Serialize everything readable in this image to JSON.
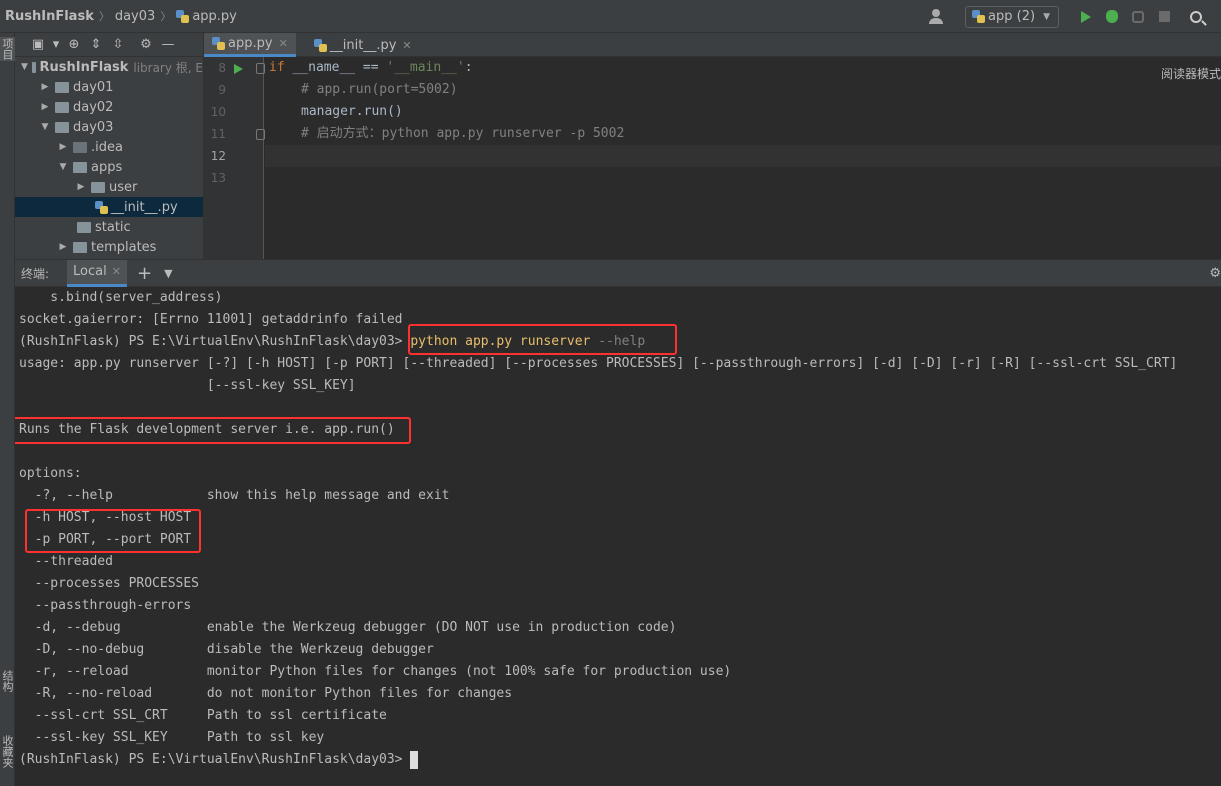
{
  "breadcrumb": {
    "root": "RushInFlask",
    "folder": "day03",
    "file": "app.py"
  },
  "run_config": {
    "label": "app (2)"
  },
  "left_strip": {
    "project_tab": "项目",
    "structure_tab": "结构",
    "favorites_tab": "收藏夹"
  },
  "project": {
    "root_label": "RushInFlask",
    "root_hint": "library 根, E",
    "items": [
      {
        "label": "day01"
      },
      {
        "label": "day02"
      },
      {
        "label": "day03"
      },
      {
        "label": ".idea"
      },
      {
        "label": "apps"
      },
      {
        "label": "user"
      },
      {
        "label": "__init__.py"
      },
      {
        "label": "static"
      },
      {
        "label": "templates"
      }
    ]
  },
  "editor": {
    "tabs": [
      {
        "label": "app.py"
      },
      {
        "label": "__init__.py"
      }
    ],
    "reader_mode": "阅读器模式",
    "lines": [
      {
        "no": "8"
      },
      {
        "no": "9"
      },
      {
        "no": "10"
      },
      {
        "no": "11"
      },
      {
        "no": "12"
      },
      {
        "no": "13"
      }
    ],
    "code": {
      "l8_kw": "if",
      "l8_mid": " __name__ == ",
      "l8_str": "'__main__'",
      "l8_end": ":",
      "l9": "# app.run(port=5002)",
      "l10": "manager.run()",
      "l11": "# 启动方式：python app.py runserver -p 5002"
    }
  },
  "terminal": {
    "title": "终端:",
    "tab": "Local",
    "lines": {
      "l1": "    s.bind(server_address)",
      "l2": "socket.gaierror: [Errno 11001] getaddrinfo failed",
      "l3_prompt": "(RushInFlask) PS E:\\VirtualEnv\\RushInFlask\\day03> ",
      "l3_cmd": "python app.py runserver ",
      "l3_flag": "--help",
      "l4": "usage: app.py runserver [-?] [-h HOST] [-p PORT] [--threaded] [--processes PROCESSES] [--passthrough-errors] [-d] [-D] [-r] [-R] [--ssl-crt SSL_CRT]",
      "l5": "                        [--ssl-key SSL_KEY]",
      "l7": "Runs the Flask development server i.e. app.run()",
      "l9": "options:",
      "l10": "  -?, --help            show this help message and exit",
      "l11": "  -h HOST, --host HOST",
      "l12": "  -p PORT, --port PORT",
      "l13": "  --threaded",
      "l14": "  --processes PROCESSES",
      "l15": "  --passthrough-errors",
      "l16": "  -d, --debug           enable the Werkzeug debugger (DO NOT use in production code)",
      "l17": "  -D, --no-debug        disable the Werkzeug debugger",
      "l18": "  -r, --reload          monitor Python files for changes (not 100% safe for production use)",
      "l19": "  -R, --no-reload       do not monitor Python files for changes",
      "l20": "  --ssl-crt SSL_CRT     Path to ssl certificate",
      "l21": "  --ssl-key SSL_KEY     Path to ssl key",
      "l22": "(RushInFlask) PS E:\\VirtualEnv\\RushInFlask\\day03> "
    }
  },
  "colors": {
    "highlight_box": "#ff3030",
    "accent": "#4a88c7"
  }
}
